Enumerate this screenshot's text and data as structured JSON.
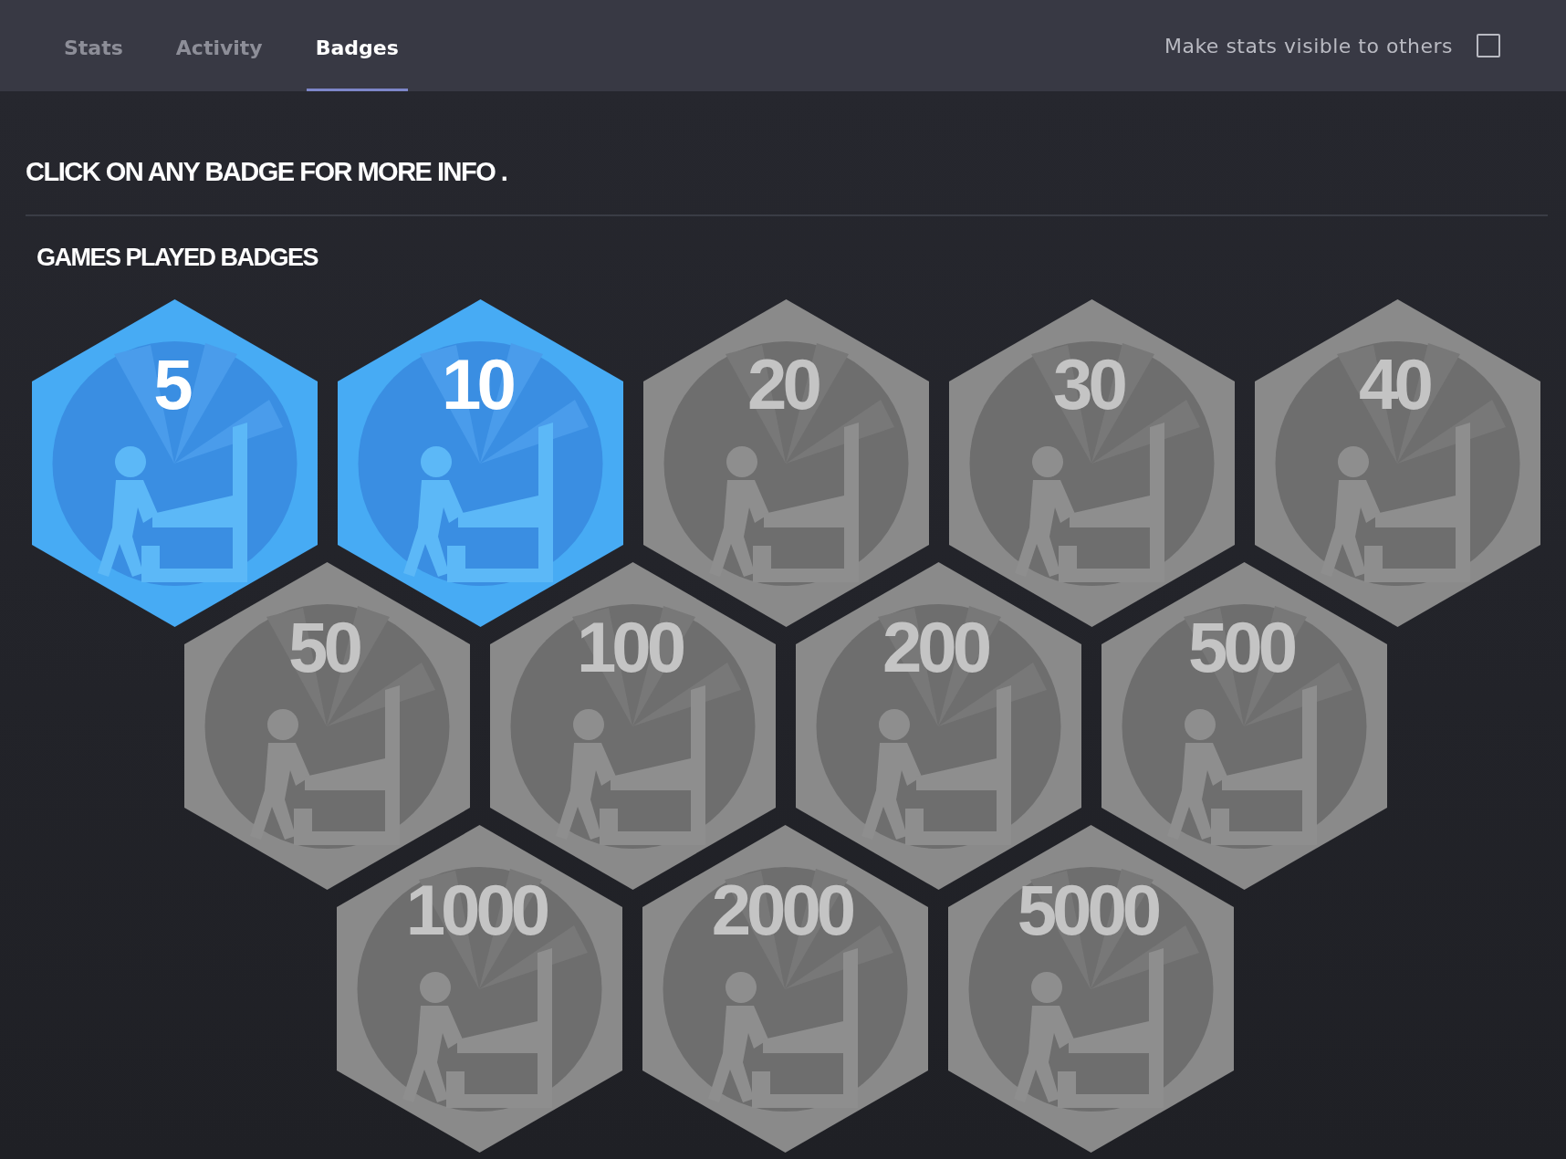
{
  "tabs": [
    {
      "label": "Stats",
      "selected": false
    },
    {
      "label": "Activity",
      "selected": false
    },
    {
      "label": "Badges",
      "selected": true
    }
  ],
  "visibility": {
    "label": "Make stats visible to others",
    "checked": false
  },
  "instruction": "CLICK ON ANY BADGE FOR MORE INFO .",
  "section": {
    "title": "GAMES PLAYED BADGES",
    "rows": [
      [
        {
          "label": "5",
          "earned": true
        },
        {
          "label": "10",
          "earned": true
        },
        {
          "label": "20",
          "earned": false
        },
        {
          "label": "30",
          "earned": false
        },
        {
          "label": "40",
          "earned": false
        }
      ],
      [
        {
          "label": "50",
          "earned": false
        },
        {
          "label": "100",
          "earned": false
        },
        {
          "label": "200",
          "earned": false
        },
        {
          "label": "500",
          "earned": false
        }
      ],
      [
        {
          "label": "1000",
          "earned": false
        },
        {
          "label": "2000",
          "earned": false
        },
        {
          "label": "5000",
          "earned": false
        }
      ]
    ]
  }
}
